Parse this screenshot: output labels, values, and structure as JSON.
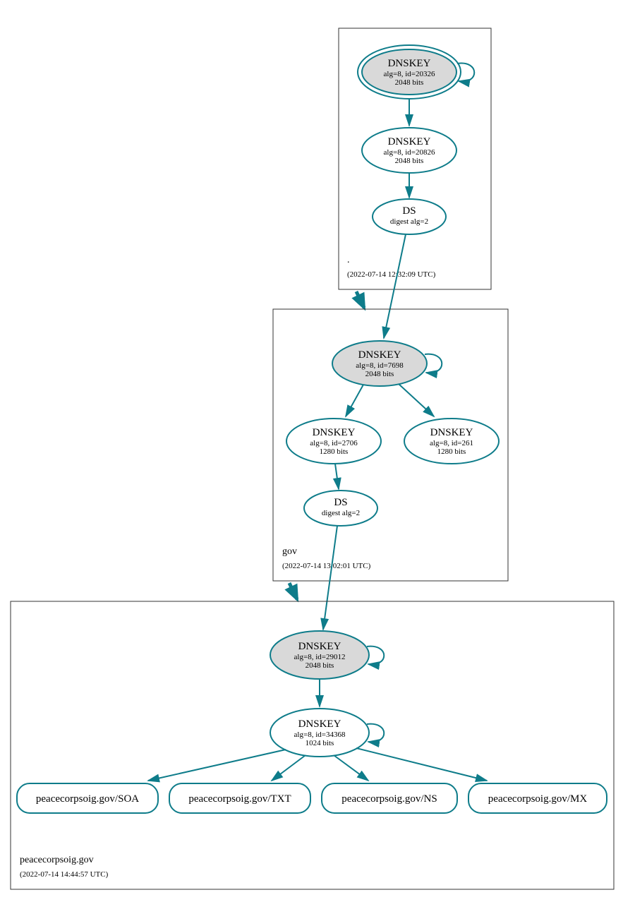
{
  "zones": {
    "root": {
      "label": ".",
      "date": "(2022-07-14 12:32:09 UTC)",
      "ksk": {
        "title": "DNSKEY",
        "line1": "alg=8, id=20326",
        "line2": "2048 bits"
      },
      "zsk": {
        "title": "DNSKEY",
        "line1": "alg=8, id=20826",
        "line2": "2048 bits"
      },
      "ds": {
        "title": "DS",
        "line1": "digest alg=2"
      }
    },
    "gov": {
      "label": "gov",
      "date": "(2022-07-14 13:02:01 UTC)",
      "ksk": {
        "title": "DNSKEY",
        "line1": "alg=8, id=7698",
        "line2": "2048 bits"
      },
      "zsk1": {
        "title": "DNSKEY",
        "line1": "alg=8, id=2706",
        "line2": "1280 bits"
      },
      "zsk2": {
        "title": "DNSKEY",
        "line1": "alg=8, id=261",
        "line2": "1280 bits"
      },
      "ds": {
        "title": "DS",
        "line1": "digest alg=2"
      }
    },
    "domain": {
      "label": "peacecorpsoig.gov",
      "date": "(2022-07-14 14:44:57 UTC)",
      "ksk": {
        "title": "DNSKEY",
        "line1": "alg=8, id=29012",
        "line2": "2048 bits"
      },
      "zsk": {
        "title": "DNSKEY",
        "line1": "alg=8, id=34368",
        "line2": "1024 bits"
      },
      "records": {
        "soa": "peacecorpsoig.gov/SOA",
        "txt": "peacecorpsoig.gov/TXT",
        "ns": "peacecorpsoig.gov/NS",
        "mx": "peacecorpsoig.gov/MX"
      }
    }
  }
}
